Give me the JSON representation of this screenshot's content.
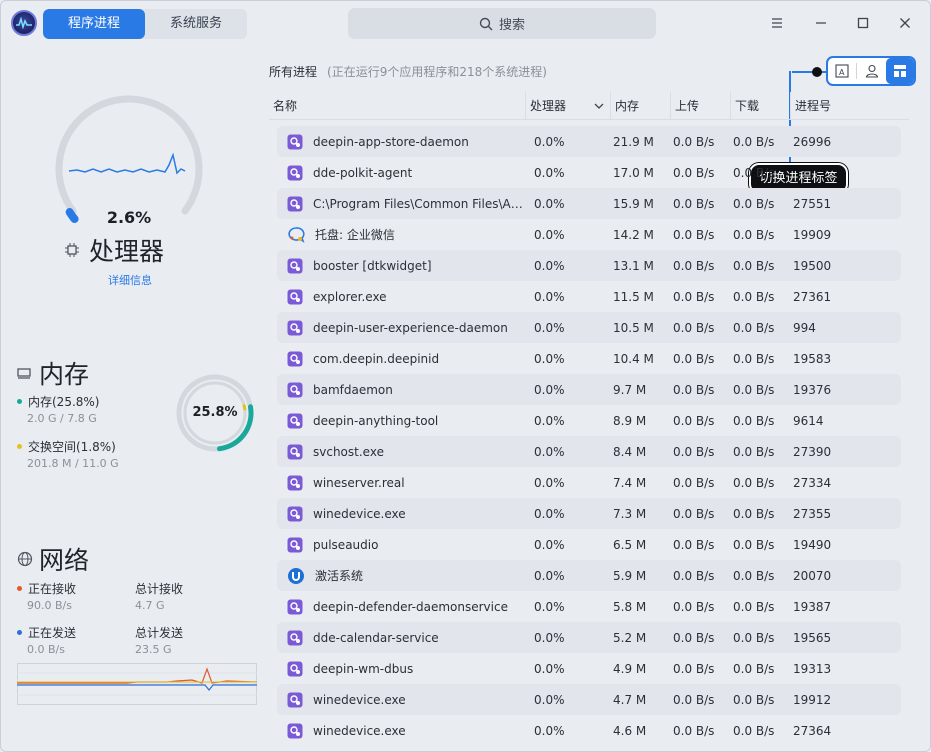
{
  "title_tabs": [
    {
      "label": "程序进程",
      "active": true
    },
    {
      "label": "系统服务",
      "active": false
    }
  ],
  "search": {
    "label": "搜索"
  },
  "cpu": {
    "percent": "2.6%",
    "title": "处理器",
    "detail_link": "详细信息",
    "usage_fraction": 0.026
  },
  "memory": {
    "title": "内存",
    "percent": "25.8%",
    "usage_fraction": 0.258,
    "swap_fraction": 0.018,
    "mem_label": "内存(25.8%)",
    "mem_value": "2.0 G / 7.8 G",
    "swap_label": "交换空间(1.8%)",
    "swap_value": "201.8 M / 11.0 G"
  },
  "network": {
    "title": "网络",
    "recv_label": "正在接收",
    "recv_value": "90.0 B/s",
    "total_recv_label": "总计接收",
    "total_recv_value": "4.7 G",
    "send_label": "正在发送",
    "send_value": "0.0 B/s",
    "total_send_label": "总计发送",
    "total_send_value": "23.5 G"
  },
  "list": {
    "heading": "所有进程",
    "hint": "(正在运行9个应用程序和218个系统进程)",
    "callout": "切换进程标签",
    "columns": {
      "name": "名称",
      "cpu": "处理器",
      "mem": "内存",
      "up": "上传",
      "down": "下载",
      "pid": "进程号"
    },
    "rows": [
      {
        "name": "deepin-app-store-daemon",
        "cpu": "0.0%",
        "mem": "21.9 M",
        "up": "0.0 B/s",
        "down": "0.0 B/s",
        "pid": "26996",
        "icon": "process-icon"
      },
      {
        "name": "dde-polkit-agent",
        "cpu": "0.0%",
        "mem": "17.0 M",
        "up": "0.0 B/s",
        "down": "0.0 B/s",
        "pid": "",
        "icon": "process-icon"
      },
      {
        "name": "C:\\Program Files\\Common Files\\A…",
        "cpu": "0.0%",
        "mem": "15.9 M",
        "up": "0.0 B/s",
        "down": "0.0 B/s",
        "pid": "27551",
        "icon": "process-icon"
      },
      {
        "name": "托盘: 企业微信",
        "cpu": "0.0%",
        "mem": "14.2 M",
        "up": "0.0 B/s",
        "down": "0.0 B/s",
        "pid": "19909",
        "icon": "wecom-icon"
      },
      {
        "name": "booster [dtkwidget]",
        "cpu": "0.0%",
        "mem": "13.1 M",
        "up": "0.0 B/s",
        "down": "0.0 B/s",
        "pid": "19500",
        "icon": "process-icon"
      },
      {
        "name": "explorer.exe",
        "cpu": "0.0%",
        "mem": "11.5 M",
        "up": "0.0 B/s",
        "down": "0.0 B/s",
        "pid": "27361",
        "icon": "process-icon"
      },
      {
        "name": "deepin-user-experience-daemon",
        "cpu": "0.0%",
        "mem": "10.5 M",
        "up": "0.0 B/s",
        "down": "0.0 B/s",
        "pid": "994",
        "icon": "process-icon"
      },
      {
        "name": "com.deepin.deepinid",
        "cpu": "0.0%",
        "mem": "10.4 M",
        "up": "0.0 B/s",
        "down": "0.0 B/s",
        "pid": "19583",
        "icon": "process-icon"
      },
      {
        "name": "bamfdaemon",
        "cpu": "0.0%",
        "mem": "9.7 M",
        "up": "0.0 B/s",
        "down": "0.0 B/s",
        "pid": "19376",
        "icon": "process-icon"
      },
      {
        "name": "deepin-anything-tool",
        "cpu": "0.0%",
        "mem": "8.9 M",
        "up": "0.0 B/s",
        "down": "0.0 B/s",
        "pid": "9614",
        "icon": "process-icon"
      },
      {
        "name": "svchost.exe",
        "cpu": "0.0%",
        "mem": "8.4 M",
        "up": "0.0 B/s",
        "down": "0.0 B/s",
        "pid": "27390",
        "icon": "process-icon"
      },
      {
        "name": "wineserver.real",
        "cpu": "0.0%",
        "mem": "7.4 M",
        "up": "0.0 B/s",
        "down": "0.0 B/s",
        "pid": "27334",
        "icon": "process-icon"
      },
      {
        "name": "winedevice.exe",
        "cpu": "0.0%",
        "mem": "7.3 M",
        "up": "0.0 B/s",
        "down": "0.0 B/s",
        "pid": "27355",
        "icon": "process-icon"
      },
      {
        "name": "pulseaudio",
        "cpu": "0.0%",
        "mem": "6.5 M",
        "up": "0.0 B/s",
        "down": "0.0 B/s",
        "pid": "19490",
        "icon": "process-icon"
      },
      {
        "name": "激活系统",
        "cpu": "0.0%",
        "mem": "5.9 M",
        "up": "0.0 B/s",
        "down": "0.0 B/s",
        "pid": "20070",
        "icon": "activation-icon"
      },
      {
        "name": "deepin-defender-daemonservice",
        "cpu": "0.0%",
        "mem": "5.8 M",
        "up": "0.0 B/s",
        "down": "0.0 B/s",
        "pid": "19387",
        "icon": "process-icon"
      },
      {
        "name": "dde-calendar-service",
        "cpu": "0.0%",
        "mem": "5.2 M",
        "up": "0.0 B/s",
        "down": "0.0 B/s",
        "pid": "19565",
        "icon": "process-icon"
      },
      {
        "name": "deepin-wm-dbus",
        "cpu": "0.0%",
        "mem": "4.9 M",
        "up": "0.0 B/s",
        "down": "0.0 B/s",
        "pid": "19313",
        "icon": "process-icon"
      },
      {
        "name": "winedevice.exe",
        "cpu": "0.0%",
        "mem": "4.7 M",
        "up": "0.0 B/s",
        "down": "0.0 B/s",
        "pid": "19912",
        "icon": "process-icon"
      },
      {
        "name": "winedevice.exe",
        "cpu": "0.0%",
        "mem": "4.6 M",
        "up": "0.0 B/s",
        "down": "0.0 B/s",
        "pid": "27364",
        "icon": "process-icon"
      }
    ]
  },
  "colors": {
    "accent": "#2a7ae6",
    "swap": "#e3c21f",
    "recv": "#e05a2c",
    "send": "#2f6fd8",
    "mem_ring": "#1aa89a"
  }
}
